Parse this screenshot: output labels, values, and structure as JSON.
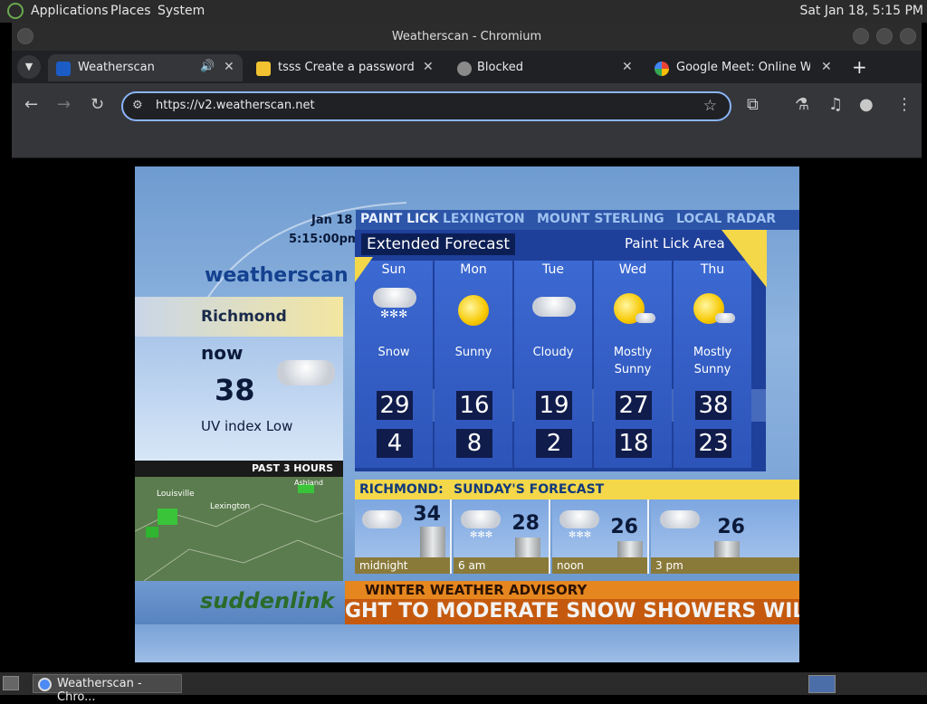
{
  "top_panel": {
    "menus": [
      "Applications",
      "Places",
      "System"
    ],
    "clock": "Sat Jan 18,  5:15 PM"
  },
  "window": {
    "title": "Weatherscan - Chromium"
  },
  "tabs": [
    {
      "label": "Weatherscan",
      "active": true,
      "favicon": "weatherscan-favicon"
    },
    {
      "label": "tsss Create a password-p",
      "active": false,
      "favicon": "emoji-favicon"
    },
    {
      "label": "Blocked",
      "active": false,
      "favicon": "globe-icon"
    },
    {
      "label": "Google Meet: Online Web",
      "active": false,
      "favicon": "google-icon"
    }
  ],
  "toolbar": {
    "url": "https://v2.weatherscan.net"
  },
  "weatherscan": {
    "date": "Jan 18",
    "time": "5:15:00pm",
    "brand": "weatherscan",
    "city": "Richmond",
    "now_label": "now",
    "now_temp": "38",
    "uv_text": "UV index Low",
    "radar_label": "PAST 3 HOURS",
    "map_labels": [
      "Louisville",
      "Lexington",
      "Ashland"
    ],
    "locations": [
      "PAINT LICK",
      "LEXINGTON",
      "MOUNT STERLING",
      "LOCAL RADAR"
    ],
    "ext_title": "Extended Forecast",
    "ext_area": "Paint Lick Area",
    "days": [
      {
        "name": "Sun",
        "cond": "Snow",
        "hi": "29",
        "lo": "4",
        "icon": "snow-cloud-icon"
      },
      {
        "name": "Mon",
        "cond": "Sunny",
        "hi": "16",
        "lo": "8",
        "icon": "sun-icon"
      },
      {
        "name": "Tue",
        "cond": "Cloudy",
        "hi": "19",
        "lo": "2",
        "icon": "cloud-icon"
      },
      {
        "name": "Wed",
        "cond": "Mostly Sunny",
        "hi": "27",
        "lo": "18",
        "icon": "mostly-sunny-icon"
      },
      {
        "name": "Thu",
        "cond": "Mostly Sunny",
        "hi": "38",
        "lo": "23",
        "icon": "mostly-sunny-icon"
      }
    ],
    "rich_city": "RICHMOND:",
    "rich_title": "SUNDAY'S FORECAST",
    "hours": [
      {
        "label": "midnight",
        "temp": "34",
        "icon": "cloud-icon"
      },
      {
        "label": "6 am",
        "temp": "28",
        "icon": "snow-cloud-icon"
      },
      {
        "label": "noon",
        "temp": "26",
        "icon": "snow-cloud-icon"
      },
      {
        "label": "3 pm",
        "temp": "26",
        "icon": "cloud-icon"
      }
    ],
    "advisory_title": "WINTER WEATHER ADVISORY",
    "advisory_scroll": "GHT TO MODERATE SNOW SHOWERS WILL",
    "sponsor": "suddenlink"
  },
  "taskbar": {
    "task_label": "Weatherscan - Chro..."
  }
}
